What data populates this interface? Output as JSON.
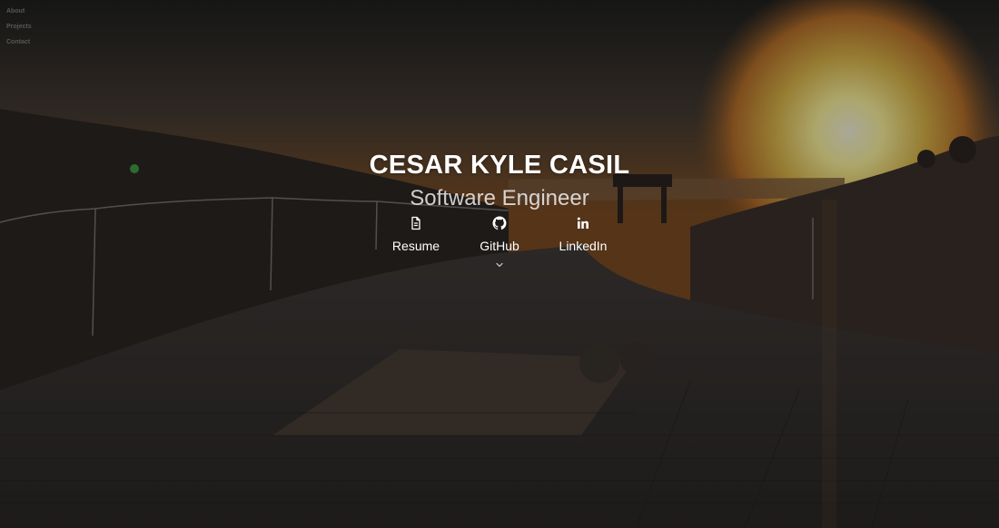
{
  "nav": {
    "items": [
      "About",
      "Projects",
      "Contact"
    ]
  },
  "hero": {
    "name": "CESAR KYLE CASIL",
    "role": "Software Engineer",
    "links": [
      {
        "label": "Resume",
        "icon": "document-icon"
      },
      {
        "label": "GitHub",
        "icon": "github-icon"
      },
      {
        "label": "LinkedIn",
        "icon": "linkedin-icon"
      }
    ],
    "scroll_icon": "chevron-down-icon"
  },
  "colors": {
    "nav_text": "#5b5552",
    "hero_text": "#ffffff",
    "subtitle_text": "#c9c4c1"
  }
}
